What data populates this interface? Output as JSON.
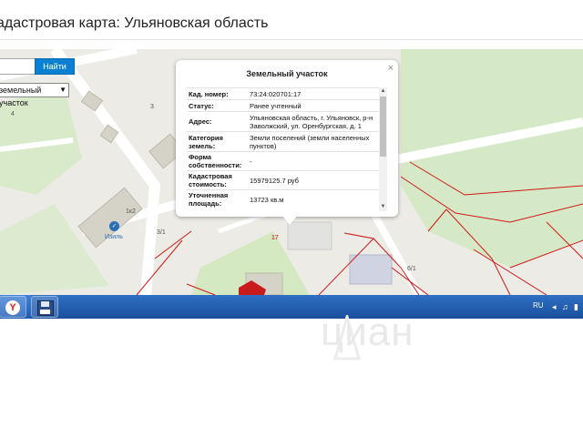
{
  "header": {
    "title": "адастровая карта: Ульяновская область"
  },
  "search": {
    "value": "",
    "button_label": "Найти"
  },
  "layer_select": {
    "selected": "земельный участок"
  },
  "popup": {
    "title": "Земельный участок",
    "close": "×",
    "rows": [
      {
        "label": "Кад. номер:",
        "value": "73:24:020701:17"
      },
      {
        "label": "Статус:",
        "value": "Ранее учтенный"
      },
      {
        "label": "Адрес:",
        "value": "Ульяновская область, г. Ульяновск, р-н Заволжский, ул. Оренбургская, д. 1"
      },
      {
        "label": "Категория земель:",
        "value": "Земли поселений (земли населенных пунктов)"
      },
      {
        "label": "Форма собственности:",
        "value": "-"
      },
      {
        "label": "Кадастровая стоимость:",
        "value": "15979125.7 руб"
      },
      {
        "label": "Уточненная площадь:",
        "value": "13723 кв.м"
      }
    ]
  },
  "map": {
    "building_label": "1к2",
    "poi_label": "Изиль",
    "parcel_number": "17",
    "labels": [
      "3",
      "3/1",
      "4",
      "6/1"
    ],
    "colors": {
      "parcel_border": "#d01818",
      "road": "#ffffff",
      "grass": "#d6e9c6",
      "building": "#d5d2c8",
      "parcel_fill": "#c81b1b"
    }
  },
  "taskbar": {
    "lang": "RU"
  },
  "watermark": {
    "text": "циан"
  }
}
